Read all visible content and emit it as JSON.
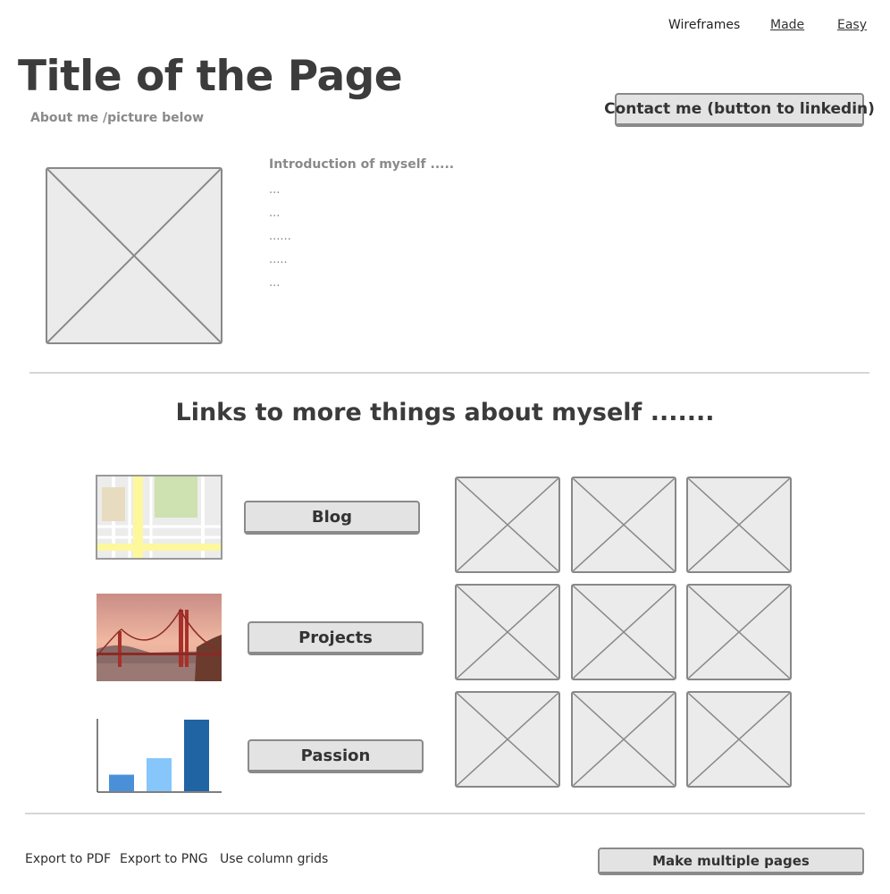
{
  "nav": {
    "items": [
      {
        "label": "Wireframes"
      },
      {
        "label": "Made"
      },
      {
        "label": "Easy"
      }
    ]
  },
  "header": {
    "title": "Title of the Page",
    "subtitle": "About me /picture below",
    "contact_button": "Contact me (button to linkedin)"
  },
  "intro": {
    "heading": "Introduction of myself .....",
    "lines": [
      "...",
      "...",
      "......",
      ".....",
      "..."
    ]
  },
  "links_section": {
    "heading": "Links to more things about myself .......",
    "buttons": [
      {
        "label": "Blog"
      },
      {
        "label": "Projects"
      },
      {
        "label": "Passion"
      }
    ],
    "bar_chart": {
      "type": "bar",
      "values": [
        3,
        6,
        13
      ],
      "colors": [
        "#4a90d9",
        "#86c6fb",
        "#2064a4"
      ]
    }
  },
  "footer": {
    "links": [
      {
        "label": "Export to PDF"
      },
      {
        "label": "Export to PNG"
      },
      {
        "label": "Use column grids"
      }
    ],
    "button": "Make multiple pages"
  },
  "colors": {
    "placeholder_bg": "#ebebeb",
    "placeholder_border": "#888888",
    "button_bg": "#e3e3e3",
    "map_road": "#fdf89c",
    "map_park": "#cde2b0"
  }
}
